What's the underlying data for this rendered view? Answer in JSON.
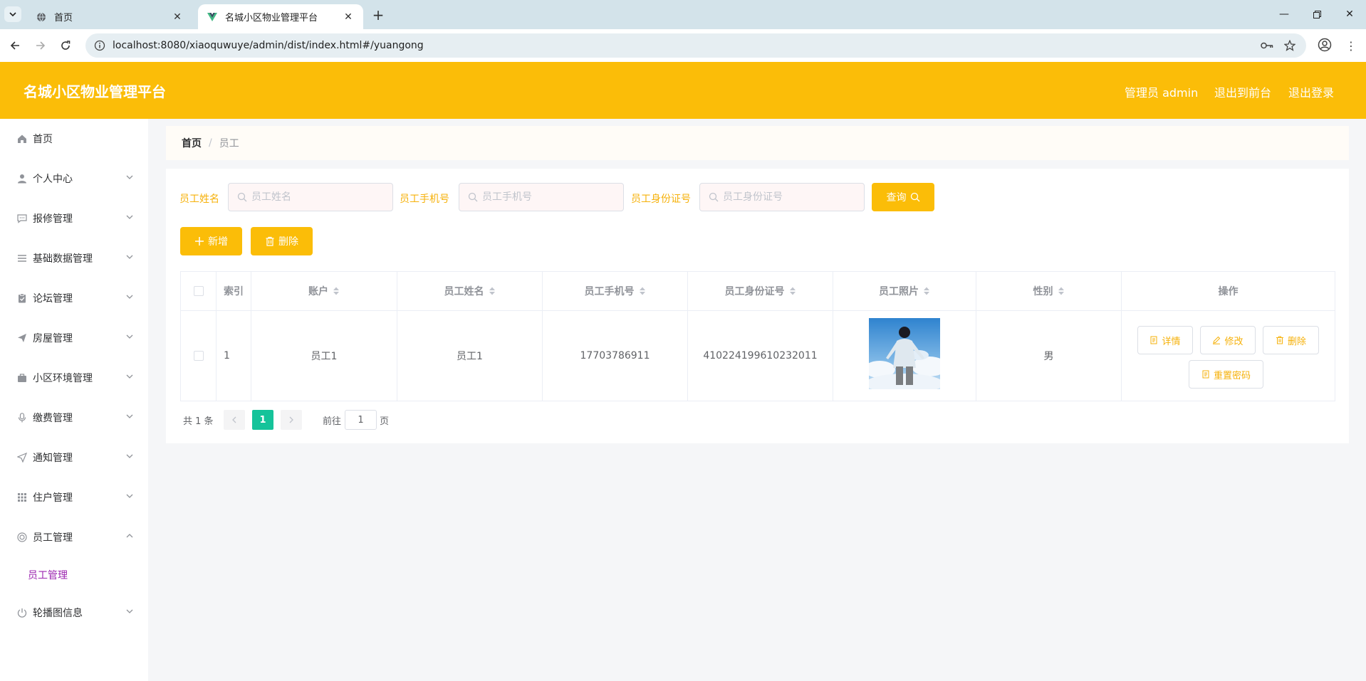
{
  "browser": {
    "tabs": [
      {
        "title": "首页"
      },
      {
        "title": "名城小区物业管理平台"
      }
    ],
    "url": "localhost:8080/xiaoquwuye/admin/dist/index.html#/yuangong"
  },
  "header": {
    "title": "名城小区物业管理平台",
    "admin_label": "管理员 admin",
    "to_front_label": "退出到前台",
    "logout_label": "退出登录"
  },
  "sidebar": {
    "items": [
      {
        "label": "首页",
        "icon": "home-icon"
      },
      {
        "label": "个人中心",
        "icon": "user-icon"
      },
      {
        "label": "报修管理",
        "icon": "chat-icon"
      },
      {
        "label": "基础数据管理",
        "icon": "menu-icon"
      },
      {
        "label": "论坛管理",
        "icon": "clipboard-icon"
      },
      {
        "label": "房屋管理",
        "icon": "send-icon"
      },
      {
        "label": "小区环境管理",
        "icon": "suitcase-icon"
      },
      {
        "label": "缴费管理",
        "icon": "microphone-icon"
      },
      {
        "label": "通知管理",
        "icon": "position-icon"
      },
      {
        "label": "住户管理",
        "icon": "grid-icon"
      },
      {
        "label": "员工管理",
        "icon": "help-icon"
      },
      {
        "label": "员工管理"
      },
      {
        "label": "轮播图信息",
        "icon": "power-icon"
      }
    ]
  },
  "breadcrumb": {
    "home": "首页",
    "current": "员工"
  },
  "search": {
    "name_label": "员工姓名",
    "name_placeholder": "员工姓名",
    "phone_label": "员工手机号",
    "phone_placeholder": "员工手机号",
    "id_label": "员工身份证号",
    "id_placeholder": "员工身份证号",
    "query_label": "查询"
  },
  "actions": {
    "add_label": "新增",
    "delete_label": "删除"
  },
  "table": {
    "columns": [
      "索引",
      "账户",
      "员工姓名",
      "员工手机号",
      "员工身份证号",
      "员工照片",
      "性别",
      "操作"
    ],
    "rows": [
      {
        "index": "1",
        "account": "员工1",
        "name": "员工1",
        "phone": "17703786911",
        "id_number": "410224199610232011",
        "gender": "男",
        "ops": {
          "detail": "详情",
          "edit": "修改",
          "delete": "删除",
          "reset": "重置密码"
        }
      }
    ]
  },
  "pager": {
    "total": "共 1 条",
    "current": "1",
    "goto_label": "前往",
    "goto_value": "1",
    "page_label": "页"
  },
  "colors": {
    "accent": "#fbbd08",
    "label": "#f6b10a",
    "active_page": "#15c39a",
    "submenu_active": "#9c27b0"
  }
}
